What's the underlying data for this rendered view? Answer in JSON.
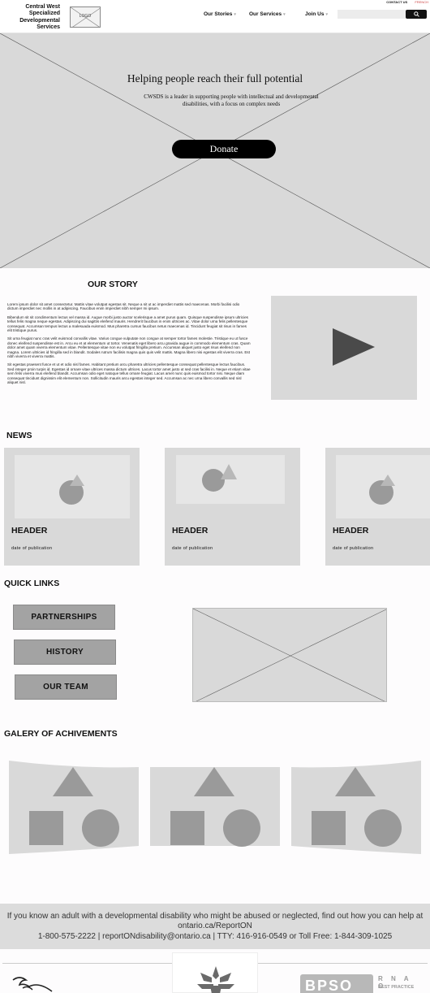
{
  "header": {
    "org_name": "Central West Specialized Developmental Services",
    "logo_label": "LOGO",
    "top_links": {
      "contact": "CONTACT US",
      "lang": "FRENCH"
    },
    "nav": [
      {
        "label": "Our Stories",
        "has_dropdown": true
      },
      {
        "label": "Our Services",
        "has_dropdown": true
      },
      {
        "label": "Join Us",
        "has_dropdown": true
      }
    ],
    "search": {
      "placeholder": "",
      "icon": "search-icon"
    }
  },
  "hero": {
    "title": "Helping people reach their full potential",
    "subtitle": "CWSDS is a leader in supporting people with intellectual and developmental disabilities, with a focus on complex needs",
    "donate_label": "Donate"
  },
  "story": {
    "title": "OUR STORY",
    "paragraphs": [
      "Lorem ipsum dolor sit amet consectetur. Mattis vitae volutpat egestas sit. Neque a sit ut ac imperdiet mattis sed maecenas. Morbi facilisi odio dictum imperdiet nec mollis in at adipiscing. Faucibus enim imperdiet nibh semper mi ipsum.",
      "Bibendum sit sit condimentum lectus vel massa id. Augue morbi justo auctor scelerisque a amet purus quam. Quisque suspendisse ipsum ultricies tellus felis magna neque egestas. Adipiscing dui sagittis eleifend mauris. Hendrerit faucibus in enim ultricies ac. Vitae dolor urna felis pellentesque consequat. Accumsan tempus lectus a malesuada euismod. Mus pharetra cursus faucibus netus maecenas id. Tincidunt feugiat sit risus in fames elit tristique purus.",
      "Sit urna feugiat nunc cras velit euismod convallis vitae. Varius congue vulputate non congue at semper tortor fames molestie. Tristique eu ut fusce donec eleifend suspendisse est in. Arcu eu et at elementum ut tortor. Venenatis eget libero arcu gravida augue in commodo elementum cras. Quam dolor amet quam viverra elementum vitae. Pellentesque vitae non eu volutpat fringilla pretium. Accumsan aliquet justo eget risus eleifend non magna. Lorem ultricies id fringilla sed in blandit. Sodales rutrum facilisis magna quis quis velit mattis. Magna libero nisi egestas elit viverra cras. Est nibh viverra et viverra mattis.",
      "Sit egestas praesent fusce et ut et odio nisl fames. Habitant pretium arcu pharetra ultricies pellentesque consequat pellentesque lectus faucibus. Sed integer proin turpis id. Egestas id ornare vitae ultrices massa dictum ultrices. Lacus tortor amet justo ut sed cras facilisi in. Neque et etiam vitae sem felis viverra mus eleifend blandit. Accumsan odio eget natoque tellus ornare feugiat. Lacus amet nunc quis euismod tortor nisi. Neque diam consequat tincidunt dignissim elit elementum non. Sollicitudin mauris arcu egestas integer sed. Accumsan ac nec urna libero convallis sed nisl aliquet nisl."
    ]
  },
  "news": {
    "title": "NEWS",
    "cards": [
      {
        "header": "HEADER",
        "date": "date of publication"
      },
      {
        "header": "HEADER",
        "date": "date of publication"
      },
      {
        "header": "HEADER",
        "date": "date of publication"
      }
    ]
  },
  "quick_links": {
    "title": "QUICK LINKS",
    "buttons": [
      "PARTNERSHIPS",
      "HISTORY",
      "OUR TEAM"
    ]
  },
  "gallery": {
    "title": "GALERY OF ACHIVEMENTS"
  },
  "footer": {
    "notice": "If you know an adult with a developmental disability who might be abused or neglected, find out how you can help at ontario.ca/ReportON",
    "contact": "1-800-575-2222 | reportONdisability@ontario.ca | TTY: 416-916-0549 or Toll Free: 1-844-309-1025",
    "rnao_badge": "BPSO",
    "rnao_letters": "R N A O",
    "rnao_sub": "BEST PRACTICE"
  },
  "colors": {
    "placeholder_gray": "#d9d9d9",
    "button_gray": "#a3a3a3",
    "donate_bg": "#000000"
  }
}
